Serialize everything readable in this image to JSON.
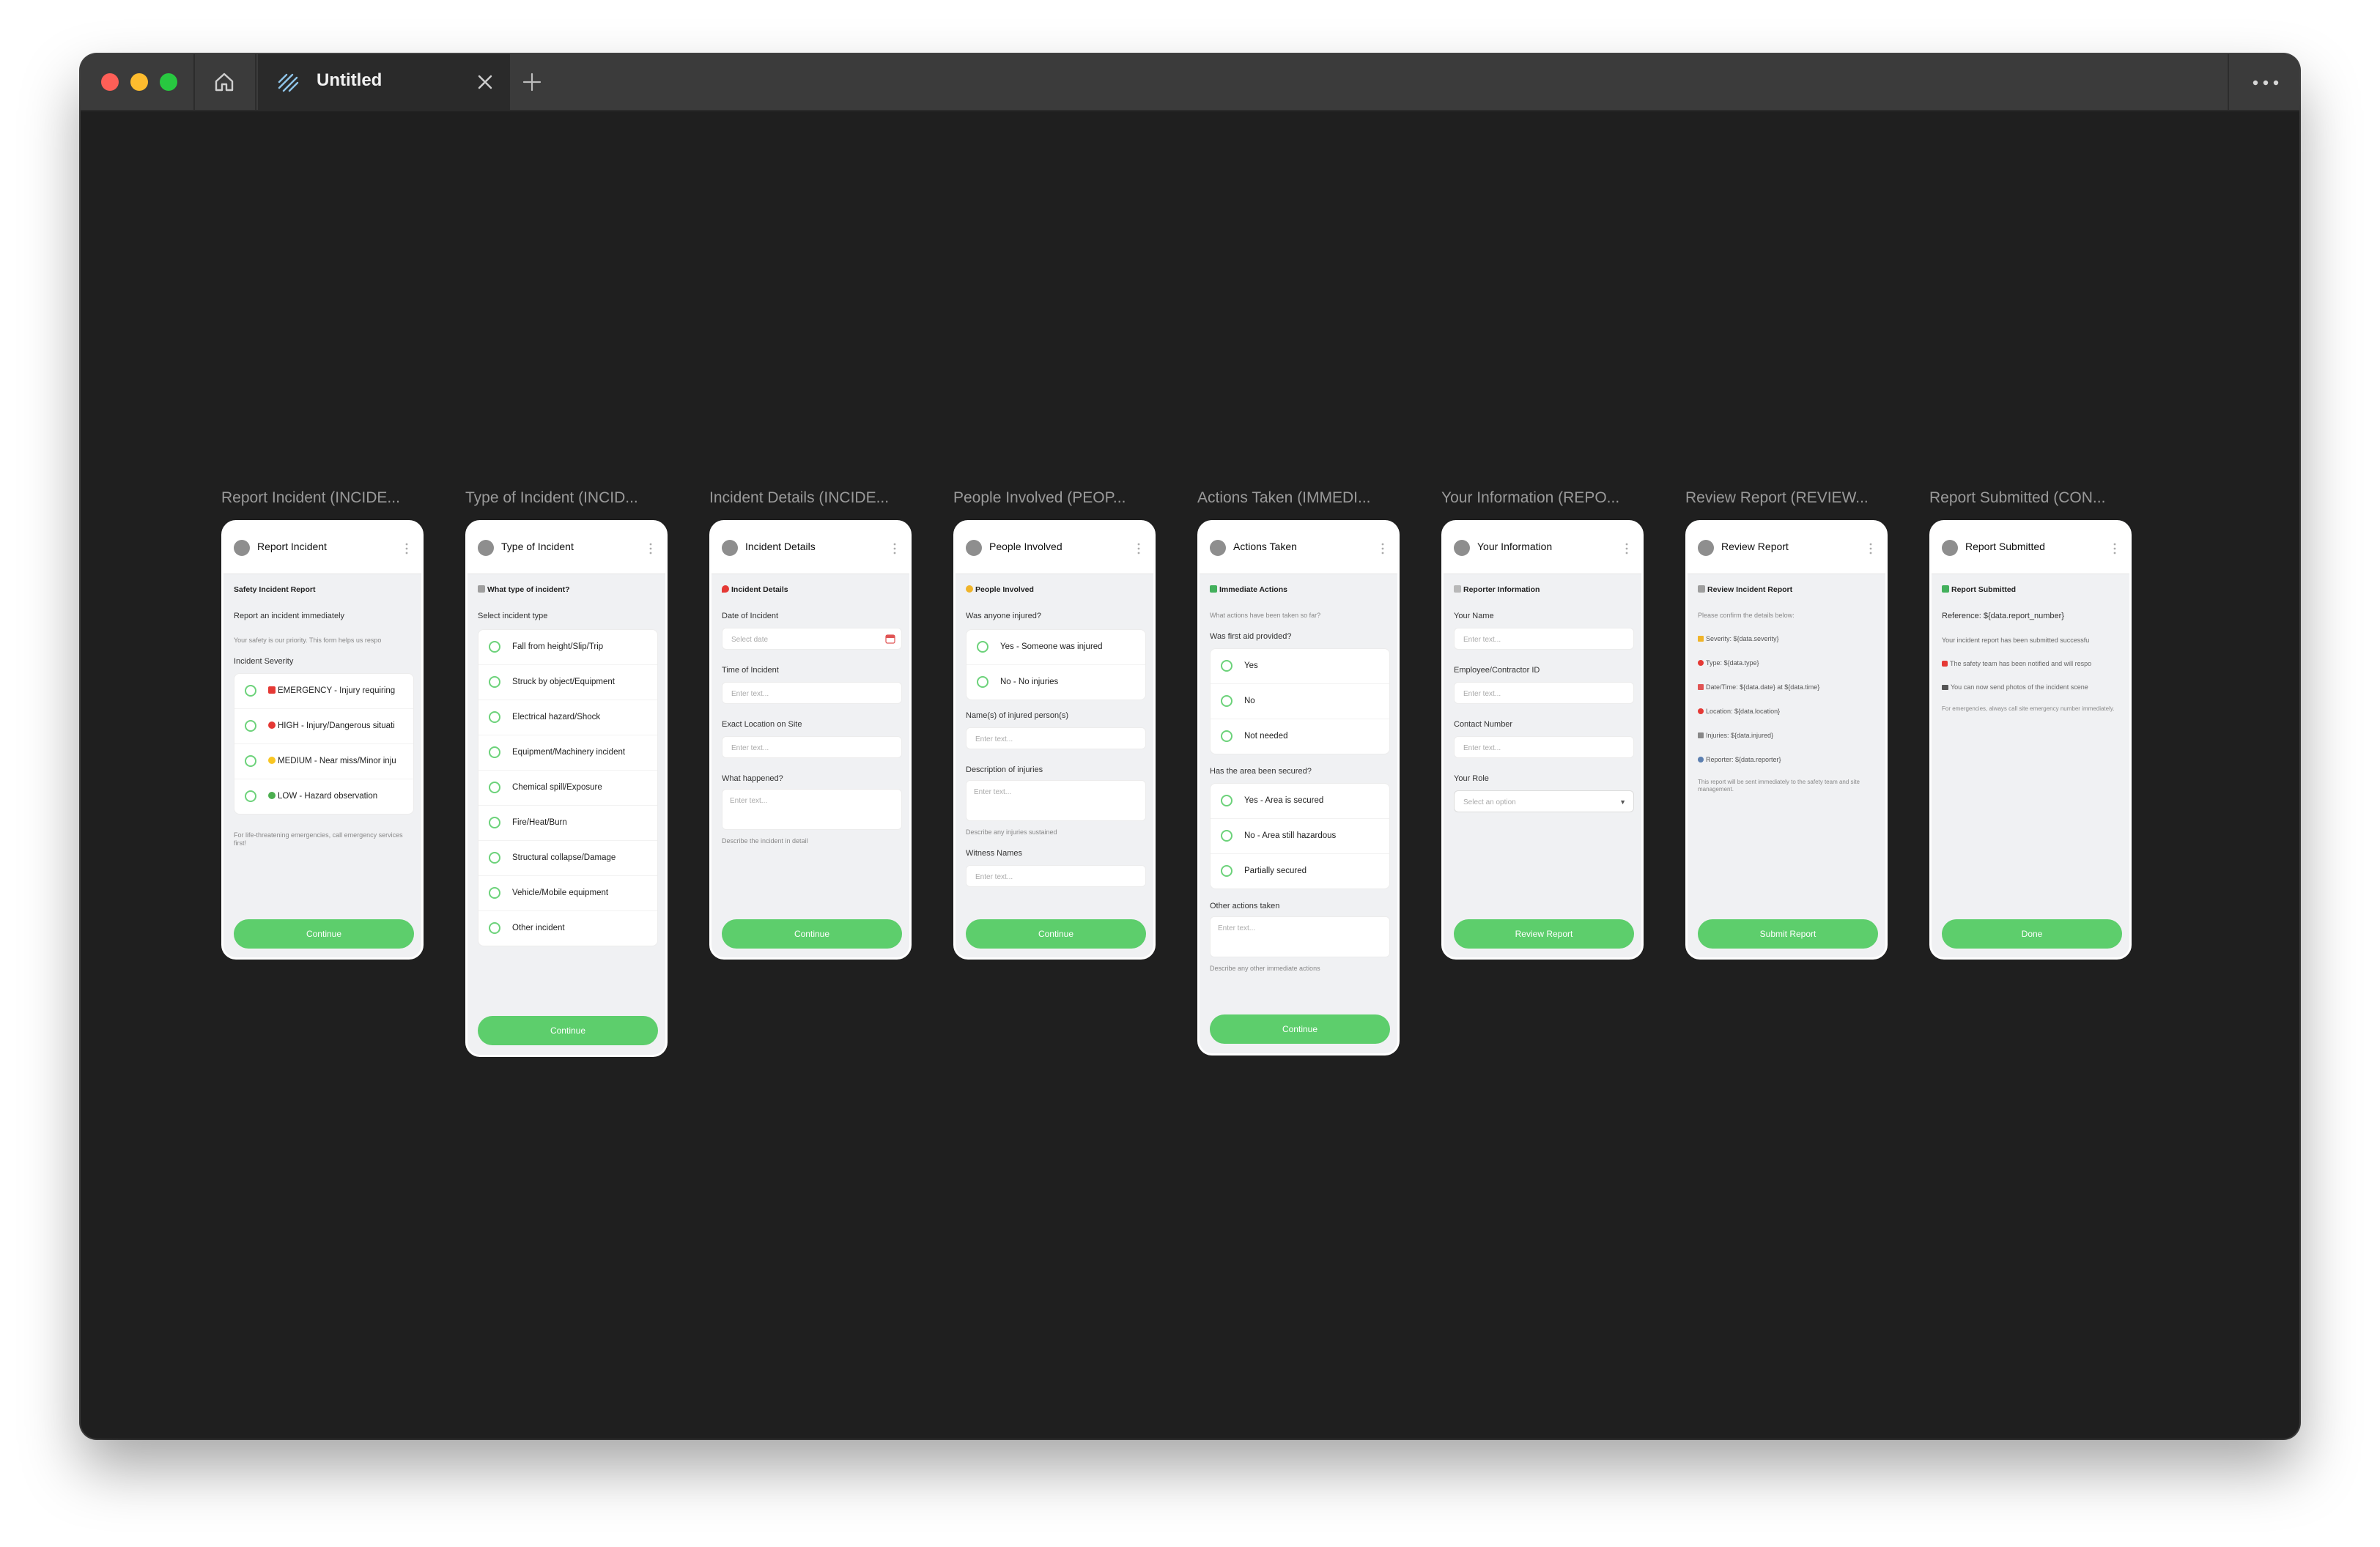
{
  "window": {
    "tab_title": "Untitled",
    "icons": {
      "home": "home-icon",
      "logo": "app-logo-icon",
      "close": "close-icon",
      "new_tab": "plus-icon",
      "more": "more-horizontal-icon"
    }
  },
  "colors": {
    "accent": "#5dce6c",
    "radio": "#6cd27a",
    "canvas": "#1f1f1f",
    "titlebar": "#3b3b3b"
  },
  "screens": [
    {
      "caption": "Report Incident (INCIDE...",
      "header": "Report Incident",
      "section": "Safety Incident Report",
      "subtitle": "Report an incident immediately",
      "intro": "Your safety is our priority. This form helps us respo",
      "severity_label": "Incident Severity",
      "options": [
        "EMERGENCY - Injury requiring",
        "HIGH - Injury/Dangerous situati",
        "MEDIUM - Near miss/Minor inju",
        "LOW - Hazard observation"
      ],
      "note": "For life-threatening emergencies, call emergency services first!",
      "button": "Continue"
    },
    {
      "caption": "Type of Incident (INCID...",
      "header": "Type of Incident",
      "section": "What type of incident?",
      "field_label": "Select incident type",
      "options": [
        "Fall from height/Slip/Trip",
        "Struck by object/Equipment",
        "Electrical hazard/Shock",
        "Equipment/Machinery incident",
        "Chemical spill/Exposure",
        "Fire/Heat/Burn",
        "Structural collapse/Damage",
        "Vehicle/Mobile equipment",
        "Other incident"
      ],
      "button": "Continue"
    },
    {
      "caption": "Incident Details (INCIDE...",
      "header": "Incident Details",
      "section": "Incident Details",
      "date_label": "Date of Incident",
      "date_placeholder": "Select date",
      "time_label": "Time of Incident",
      "time_placeholder": "Enter text...",
      "location_label": "Exact Location on Site",
      "location_placeholder": "Enter text...",
      "what_label": "What happened?",
      "what_placeholder": "Enter text...",
      "what_hint": "Describe the incident in detail",
      "button": "Continue"
    },
    {
      "caption": "People Involved (PEOP...",
      "header": "People Involved",
      "section": "People Involved",
      "injured_label": "Was anyone injured?",
      "options": [
        "Yes - Someone was injured",
        "No - No injuries"
      ],
      "names_label": "Name(s) of injured person(s)",
      "names_placeholder": "Enter text...",
      "desc_label": "Description of injuries",
      "desc_placeholder": "Enter text...",
      "desc_hint": "Describe any injuries sustained",
      "witness_label": "Witness Names",
      "witness_placeholder": "Enter text...",
      "button": "Continue"
    },
    {
      "caption": "Actions Taken (IMMEDI...",
      "header": "Actions Taken",
      "section": "Immediate Actions",
      "subtitle": "What actions have been taken so far?",
      "firstaid_label": "Was first aid provided?",
      "firstaid_options": [
        "Yes",
        "No",
        "Not needed"
      ],
      "secured_label": "Has the area been secured?",
      "secured_options": [
        "Yes - Area is secured",
        "No - Area still hazardous",
        "Partially secured"
      ],
      "other_label": "Other actions taken",
      "other_placeholder": "Enter text...",
      "other_hint": "Describe any other immediate actions",
      "button": "Continue"
    },
    {
      "caption": "Your Information (REPO...",
      "header": "Your Information",
      "section": "Reporter Information",
      "name_label": "Your Name",
      "name_placeholder": "Enter text...",
      "id_label": "Employee/Contractor ID",
      "id_placeholder": "Enter text...",
      "contact_label": "Contact Number",
      "contact_placeholder": "Enter text...",
      "role_label": "Your Role",
      "role_placeholder": "Select an option",
      "button": "Review Report"
    },
    {
      "caption": "Review Report (REVIEW...",
      "header": "Review Report",
      "section": "Review Incident Report",
      "subtitle": "Please confirm the details below:",
      "lines": [
        "Severity: ${data.severity}",
        "Type: ${data.type}",
        "Date/Time: ${data.date} at ${data.time}",
        "Location: ${data.location}",
        "Injuries: ${data.injured}",
        "Reporter: ${data.reporter}"
      ],
      "note": "This report will be sent immediately to the safety team and site management.",
      "button": "Submit Report"
    },
    {
      "caption": "Report Submitted (CON...",
      "header": "Report Submitted",
      "section": "Report Submitted",
      "reference": "Reference: ${data.report_number}",
      "line1": "Your incident report has been submitted successfu",
      "line2": "The safety team has been notified and will respo",
      "line3": "You can now send photos of the incident scene",
      "note": "For emergencies, always call site emergency number immediately.",
      "button": "Done"
    }
  ]
}
